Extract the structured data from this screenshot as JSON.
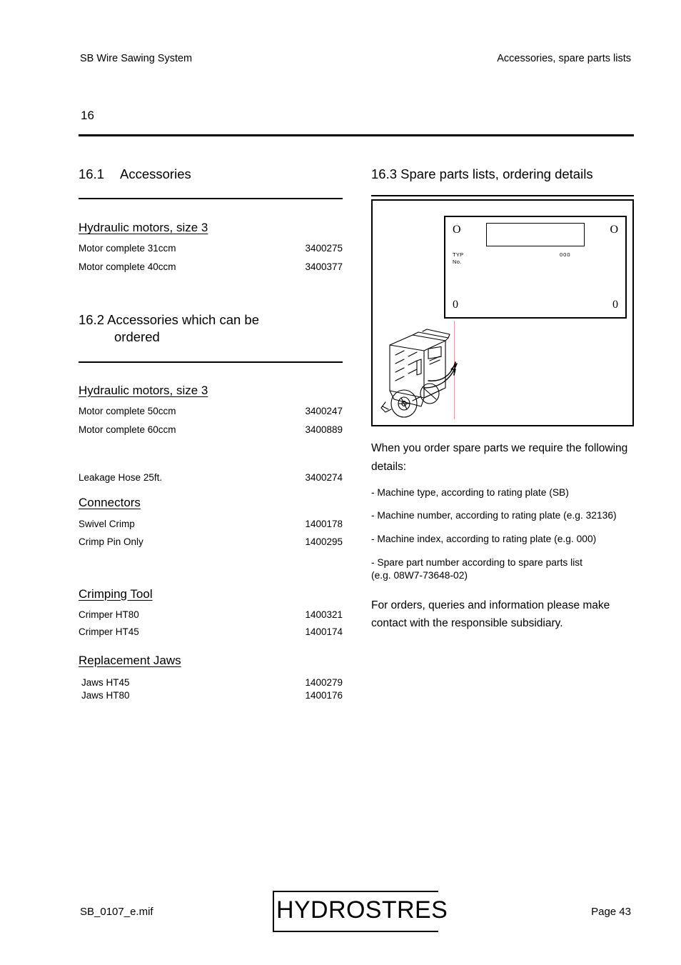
{
  "header": {
    "left": "SB Wire Sawing System",
    "right": "Accessories, spare parts lists"
  },
  "chapter": {
    "number": "16"
  },
  "sections": {
    "s161": {
      "number": "16.1",
      "title": "Accessories",
      "groups": [
        {
          "heading": "Hydraulic motors, size 3",
          "rows": [
            {
              "name": "Motor complete 31ccm",
              "part": "3400275"
            },
            {
              "name": "Motor complete 40ccm",
              "part": "3400377"
            }
          ]
        }
      ]
    },
    "s162": {
      "number": "16.2",
      "title_line1": "Accessories which can be",
      "title_line2": "ordered",
      "groups": [
        {
          "heading": "Hydraulic motors, size 3",
          "rows": [
            {
              "name": "Motor complete 50ccm",
              "part": "3400247"
            },
            {
              "name": "Motor complete 60ccm",
              "part": "3400889"
            }
          ]
        },
        {
          "heading": "",
          "rows": [
            {
              "name": "Leakage Hose 25ft.",
              "part": "3400274"
            }
          ]
        },
        {
          "heading": "Connectors",
          "rows": [
            {
              "name": "Swivel Crimp",
              "part": "1400178"
            },
            {
              "name": "Crimp Pin Only",
              "part": "1400295"
            }
          ]
        },
        {
          "heading": "Crimping Tool",
          "rows": [
            {
              "name": "Crimper HT80",
              "part": "1400321"
            },
            {
              "name": "Crimper HT45",
              "part": "1400174"
            }
          ]
        },
        {
          "heading": "Replacement Jaws",
          "rows": [
            {
              "name": "Jaws HT45",
              "part": "1400279"
            },
            {
              "name": "Jaws HT80",
              "part": "1400176"
            }
          ]
        }
      ]
    },
    "s163": {
      "number": "16.3",
      "title": "Spare parts lists, ordering details",
      "figure": {
        "plate": {
          "hole_top_left": "O",
          "hole_top_right": "O",
          "hole_bottom_left": "0",
          "hole_bottom_right": "0",
          "label_type": "TYP",
          "label_number": "No.",
          "label_index": "000"
        },
        "callout_line_color": "#e79a9f"
      },
      "intro": "When you order spare parts we require the following details:",
      "bullets": [
        "- Machine type, according to rating plate (SB)",
        "- Machine number, according to rating plate (e.g. 32136)",
        "- Machine index, according to rating plate (e.g. 000)",
        "- Spare part number according to spare parts list\n   (e.g. 08W7-73648-02)"
      ],
      "closing": "For orders, queries and information please make contact with the responsible subsidiary."
    }
  },
  "footer": {
    "file": "SB_0107_e.mif",
    "logo": "HYDROSTRES",
    "page": "Page 43"
  }
}
